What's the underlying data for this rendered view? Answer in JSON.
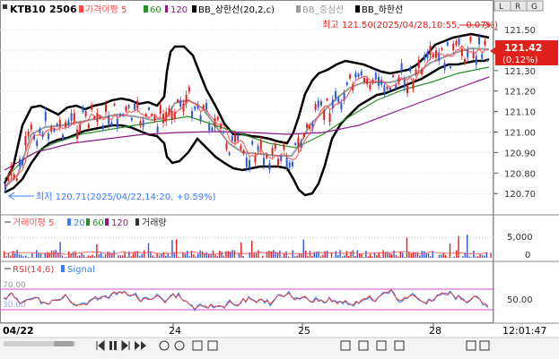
{
  "header": {
    "symbol": "KTB10",
    "contract": "2506",
    "legend": [
      {
        "label": "가격이평 5",
        "color": "#ff4d4d"
      },
      {
        "label": "60",
        "color": "#2a8f2a"
      },
      {
        "label": "120",
        "color": "#8b1a8b"
      },
      {
        "label": "BB_상한선(20,2,c)",
        "color": "#000000"
      },
      {
        "label": "BB_중심선",
        "color": "#9a9a9a"
      },
      {
        "label": "BB_하한선",
        "color": "#000000"
      }
    ]
  },
  "side_tabs": [
    "L",
    "R",
    "G"
  ],
  "annotations": {
    "high": "최고 121.50(2025/04/28,10:55, -0.07%)",
    "low": "최저 120.71(2025/04/22,14:20, +0.59%)"
  },
  "price_axis": {
    "ticks": [
      "121.50",
      "121.40",
      "121.30",
      "121.20",
      "121.10",
      "121.00",
      "120.90",
      "120.80",
      "120.70"
    ],
    "current_price": "121.42",
    "current_change": "(0.12%)",
    "accent": "#e0201b"
  },
  "volume_panel": {
    "legend": [
      {
        "label": "거래이평 5",
        "color": "#ff4d4d"
      },
      {
        "label": "20",
        "color": "#3b7cff"
      },
      {
        "label": "60",
        "color": "#2a8f2a"
      },
      {
        "label": "120",
        "color": "#8b1a8b"
      },
      {
        "label": "거래량",
        "color": "#333333"
      }
    ],
    "ticks": [
      "5,000",
      "0"
    ]
  },
  "rsi_panel": {
    "legend": [
      {
        "label": "RSI(14,6)",
        "color": "#d94040"
      },
      {
        "label": "Signal",
        "color": "#3b7cff"
      }
    ],
    "level_high": "70.00",
    "level_low": "30.00",
    "tick": "50.00"
  },
  "x_axis": {
    "labels": [
      "04/22",
      "24",
      "25",
      "28"
    ]
  },
  "status": {
    "time": "12:01:47"
  },
  "controls": {
    "icons": [
      "step-back-icon",
      "pause-icon",
      "step-forward-icon",
      "fast-forward-icon",
      "zoom-in-icon",
      "zoom-out-icon",
      "chart-type-icon",
      "settings-icon"
    ]
  },
  "colors": {
    "red": "#ff4d4d",
    "green": "#2a8f2a",
    "purple": "#8b1a8b",
    "blue": "#3b7cff",
    "gray": "#9a9a9a"
  }
}
